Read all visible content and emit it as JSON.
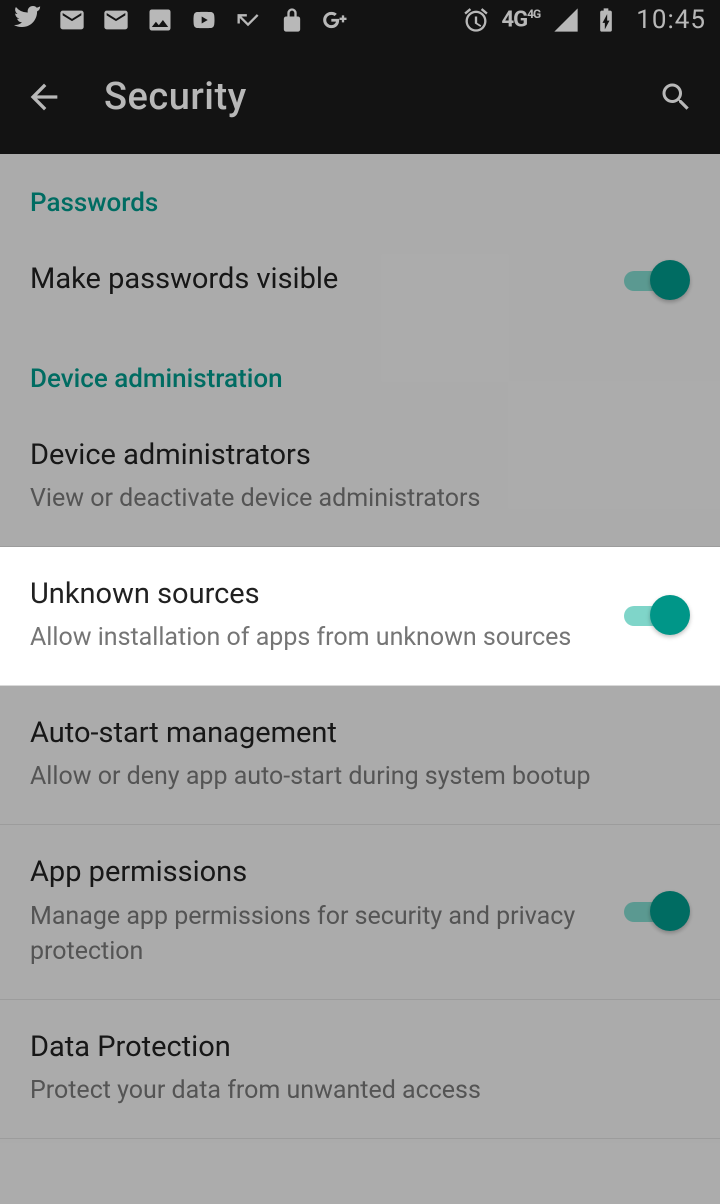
{
  "status": {
    "network": "4G",
    "network_sup": "4G",
    "time": "10:45"
  },
  "appbar": {
    "title": "Security"
  },
  "sections": {
    "passwords": {
      "header": "Passwords",
      "make_visible": {
        "title": "Make passwords visible"
      }
    },
    "device_admin": {
      "header": "Device administration",
      "administrators": {
        "title": "Device administrators",
        "sub": "View or deactivate device administrators"
      },
      "unknown_sources": {
        "title": "Unknown sources",
        "sub": "Allow installation of apps from unknown sources"
      },
      "autostart": {
        "title": "Auto-start management",
        "sub": "Allow or deny app auto-start during system bootup"
      },
      "permissions": {
        "title": "App permissions",
        "sub": "Manage app permissions for security and privacy protection"
      },
      "data_protection": {
        "title": "Data Protection",
        "sub": "Protect your data from unwanted access"
      }
    }
  }
}
